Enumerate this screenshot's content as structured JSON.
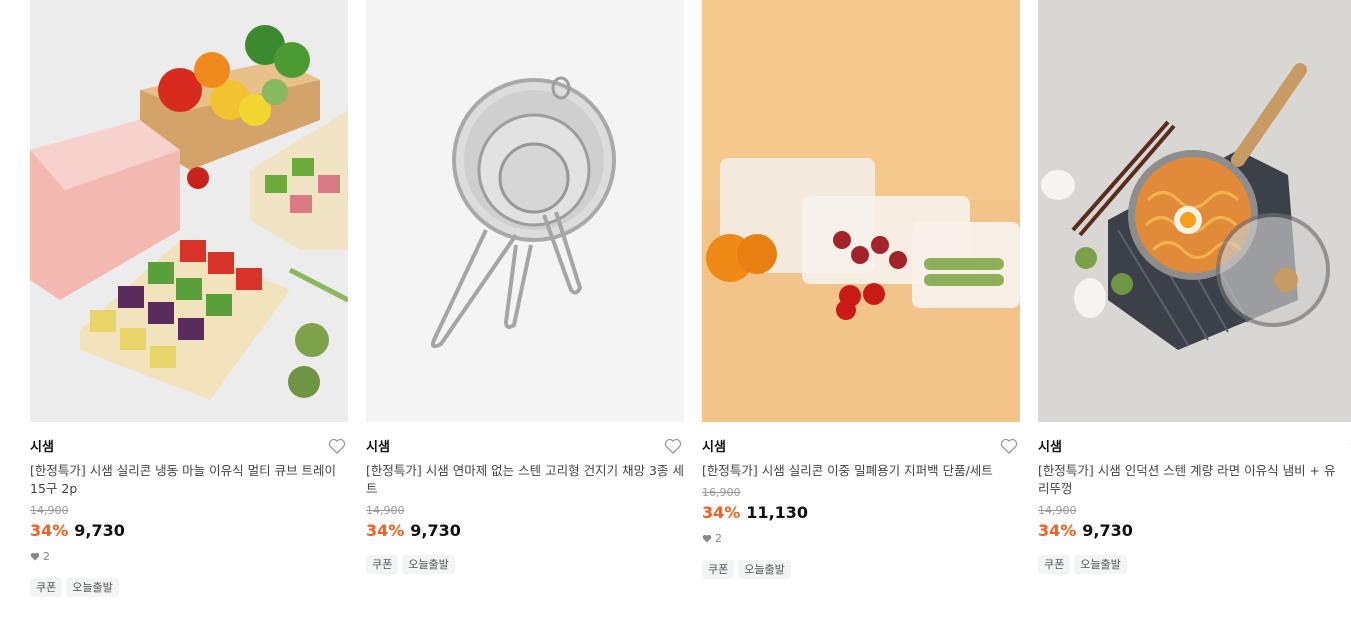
{
  "products": [
    {
      "brand": "시샘",
      "name": "[한정특가] 시샘 실리콘 냉동 마늘 이유식 멀티 큐브 트레이 15구 2p",
      "original_price": "14,900",
      "discount": "34%",
      "price": "9,730",
      "likes": "2",
      "tags": [
        "쿠폰",
        "오늘출발"
      ]
    },
    {
      "brand": "시샘",
      "name": "[한정특가] 시샘 연마제 없는 스텐 고리형 건지기 채망 3종 세트",
      "original_price": "14,900",
      "discount": "34%",
      "price": "9,730",
      "likes": null,
      "tags": [
        "쿠폰",
        "오늘출발"
      ]
    },
    {
      "brand": "시샘",
      "name": "[한정특가] 시샘 실리콘 이중 밀폐용기 지퍼백 단품/세트",
      "original_price": "16,900",
      "discount": "34%",
      "price": "11,130",
      "likes": "2",
      "tags": [
        "쿠폰",
        "오늘출발"
      ]
    },
    {
      "brand": "시샘",
      "name": "[한정특가] 시샘 인덕션 스텐 계량 라면 이유식 냄비 + 유리뚜껑",
      "original_price": "14,900",
      "discount": "34%",
      "price": "9,730",
      "likes": null,
      "tags": [
        "쿠폰",
        "오늘출발"
      ]
    }
  ],
  "colors": {
    "discount": "#ff5a1f",
    "tag_bg": "#f3f4f5"
  },
  "icons": {
    "wishlist": "heart-outline-icon",
    "like_count": "heart-filled-icon"
  }
}
